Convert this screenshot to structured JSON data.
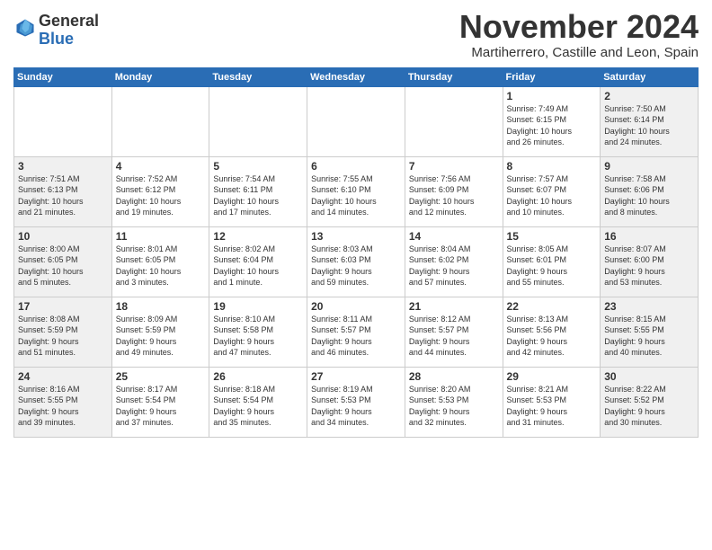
{
  "header": {
    "logo_general": "General",
    "logo_blue": "Blue",
    "month_title": "November 2024",
    "location": "Martiherrero, Castille and Leon, Spain"
  },
  "days_of_week": [
    "Sunday",
    "Monday",
    "Tuesday",
    "Wednesday",
    "Thursday",
    "Friday",
    "Saturday"
  ],
  "weeks": [
    [
      {
        "day": "",
        "info": ""
      },
      {
        "day": "",
        "info": ""
      },
      {
        "day": "",
        "info": ""
      },
      {
        "day": "",
        "info": ""
      },
      {
        "day": "",
        "info": ""
      },
      {
        "day": "1",
        "info": "Sunrise: 7:49 AM\nSunset: 6:15 PM\nDaylight: 10 hours\nand 26 minutes."
      },
      {
        "day": "2",
        "info": "Sunrise: 7:50 AM\nSunset: 6:14 PM\nDaylight: 10 hours\nand 24 minutes."
      }
    ],
    [
      {
        "day": "3",
        "info": "Sunrise: 7:51 AM\nSunset: 6:13 PM\nDaylight: 10 hours\nand 21 minutes."
      },
      {
        "day": "4",
        "info": "Sunrise: 7:52 AM\nSunset: 6:12 PM\nDaylight: 10 hours\nand 19 minutes."
      },
      {
        "day": "5",
        "info": "Sunrise: 7:54 AM\nSunset: 6:11 PM\nDaylight: 10 hours\nand 17 minutes."
      },
      {
        "day": "6",
        "info": "Sunrise: 7:55 AM\nSunset: 6:10 PM\nDaylight: 10 hours\nand 14 minutes."
      },
      {
        "day": "7",
        "info": "Sunrise: 7:56 AM\nSunset: 6:09 PM\nDaylight: 10 hours\nand 12 minutes."
      },
      {
        "day": "8",
        "info": "Sunrise: 7:57 AM\nSunset: 6:07 PM\nDaylight: 10 hours\nand 10 minutes."
      },
      {
        "day": "9",
        "info": "Sunrise: 7:58 AM\nSunset: 6:06 PM\nDaylight: 10 hours\nand 8 minutes."
      }
    ],
    [
      {
        "day": "10",
        "info": "Sunrise: 8:00 AM\nSunset: 6:05 PM\nDaylight: 10 hours\nand 5 minutes."
      },
      {
        "day": "11",
        "info": "Sunrise: 8:01 AM\nSunset: 6:05 PM\nDaylight: 10 hours\nand 3 minutes."
      },
      {
        "day": "12",
        "info": "Sunrise: 8:02 AM\nSunset: 6:04 PM\nDaylight: 10 hours\nand 1 minute."
      },
      {
        "day": "13",
        "info": "Sunrise: 8:03 AM\nSunset: 6:03 PM\nDaylight: 9 hours\nand 59 minutes."
      },
      {
        "day": "14",
        "info": "Sunrise: 8:04 AM\nSunset: 6:02 PM\nDaylight: 9 hours\nand 57 minutes."
      },
      {
        "day": "15",
        "info": "Sunrise: 8:05 AM\nSunset: 6:01 PM\nDaylight: 9 hours\nand 55 minutes."
      },
      {
        "day": "16",
        "info": "Sunrise: 8:07 AM\nSunset: 6:00 PM\nDaylight: 9 hours\nand 53 minutes."
      }
    ],
    [
      {
        "day": "17",
        "info": "Sunrise: 8:08 AM\nSunset: 5:59 PM\nDaylight: 9 hours\nand 51 minutes."
      },
      {
        "day": "18",
        "info": "Sunrise: 8:09 AM\nSunset: 5:59 PM\nDaylight: 9 hours\nand 49 minutes."
      },
      {
        "day": "19",
        "info": "Sunrise: 8:10 AM\nSunset: 5:58 PM\nDaylight: 9 hours\nand 47 minutes."
      },
      {
        "day": "20",
        "info": "Sunrise: 8:11 AM\nSunset: 5:57 PM\nDaylight: 9 hours\nand 46 minutes."
      },
      {
        "day": "21",
        "info": "Sunrise: 8:12 AM\nSunset: 5:57 PM\nDaylight: 9 hours\nand 44 minutes."
      },
      {
        "day": "22",
        "info": "Sunrise: 8:13 AM\nSunset: 5:56 PM\nDaylight: 9 hours\nand 42 minutes."
      },
      {
        "day": "23",
        "info": "Sunrise: 8:15 AM\nSunset: 5:55 PM\nDaylight: 9 hours\nand 40 minutes."
      }
    ],
    [
      {
        "day": "24",
        "info": "Sunrise: 8:16 AM\nSunset: 5:55 PM\nDaylight: 9 hours\nand 39 minutes."
      },
      {
        "day": "25",
        "info": "Sunrise: 8:17 AM\nSunset: 5:54 PM\nDaylight: 9 hours\nand 37 minutes."
      },
      {
        "day": "26",
        "info": "Sunrise: 8:18 AM\nSunset: 5:54 PM\nDaylight: 9 hours\nand 35 minutes."
      },
      {
        "day": "27",
        "info": "Sunrise: 8:19 AM\nSunset: 5:53 PM\nDaylight: 9 hours\nand 34 minutes."
      },
      {
        "day": "28",
        "info": "Sunrise: 8:20 AM\nSunset: 5:53 PM\nDaylight: 9 hours\nand 32 minutes."
      },
      {
        "day": "29",
        "info": "Sunrise: 8:21 AM\nSunset: 5:53 PM\nDaylight: 9 hours\nand 31 minutes."
      },
      {
        "day": "30",
        "info": "Sunrise: 8:22 AM\nSunset: 5:52 PM\nDaylight: 9 hours\nand 30 minutes."
      }
    ]
  ]
}
